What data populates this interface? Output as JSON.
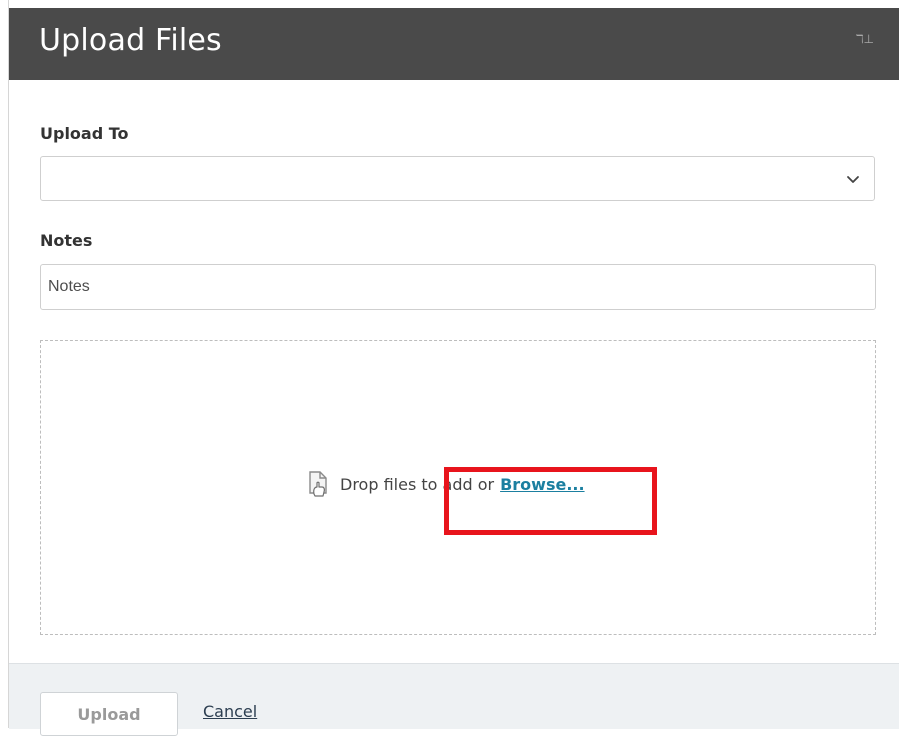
{
  "dialog": {
    "title": "Upload Files",
    "header_icon": "ℸ⊥"
  },
  "form": {
    "upload_to": {
      "label": "Upload To",
      "selected_value": ""
    },
    "notes": {
      "label": "Notes",
      "value": "",
      "placeholder": "Notes"
    }
  },
  "dropzone": {
    "text": "Drop files to add or",
    "browse_link": "Browse..."
  },
  "footer": {
    "upload_button": "Upload",
    "cancel_link": "Cancel"
  },
  "colors": {
    "header_bg": "#4a4a4a",
    "link_color": "#1b7fa0",
    "highlight_border": "#e8141c",
    "footer_bg": "#eef1f3"
  },
  "icons": {
    "header": "panel-icon",
    "select": "chevron-down-icon",
    "dropzone": "file-upload-icon"
  }
}
